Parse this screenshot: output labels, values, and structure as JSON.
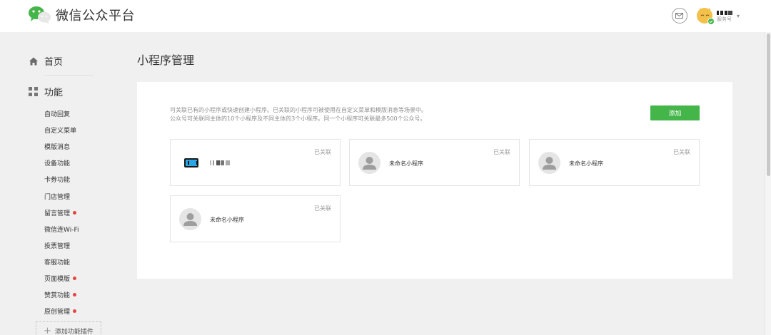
{
  "header": {
    "brand": "微信公众平台",
    "account_type": "服务号"
  },
  "sidebar": {
    "home_label": "首页",
    "function_label": "功能",
    "items": [
      {
        "label": "自动回复",
        "badge": false
      },
      {
        "label": "自定义菜单",
        "badge": false
      },
      {
        "label": "模版消息",
        "badge": false
      },
      {
        "label": "设备功能",
        "badge": false
      },
      {
        "label": "卡券功能",
        "badge": false
      },
      {
        "label": "门店管理",
        "badge": false
      },
      {
        "label": "留言管理",
        "badge": true
      },
      {
        "label": "微信连Wi-Fi",
        "badge": false
      },
      {
        "label": "投票管理",
        "badge": false
      },
      {
        "label": "客服功能",
        "badge": false
      },
      {
        "label": "页面模版",
        "badge": true
      },
      {
        "label": "赞赏功能",
        "badge": true
      },
      {
        "label": "原创管理",
        "badge": true
      }
    ],
    "add_plugin_label": "添加功能插件"
  },
  "main": {
    "title": "小程序管理",
    "desc_line1": "可关联已有的小程序或快速创建小程序。已关联的小程序可被使用在自定义菜单和模版消息等场景中。",
    "desc_line2": "公众号可关联同主体的10个小程序及不同主体的3个小程序。同一个小程序可关联最多500个公众号。",
    "add_button": "添加",
    "cards": [
      {
        "name": "",
        "status": "已关联",
        "icon": "app-icon"
      },
      {
        "name": "未命名小程序",
        "status": "已关联",
        "icon": "placeholder-avatar-icon"
      },
      {
        "name": "未命名小程序",
        "status": "已关联",
        "icon": "placeholder-avatar-icon"
      },
      {
        "name": "未命名小程序",
        "status": "已关联",
        "icon": "placeholder-avatar-icon"
      }
    ]
  },
  "colors": {
    "accent_green": "#44b549",
    "badge_red": "#e64340",
    "background": "#f0f0f0"
  }
}
